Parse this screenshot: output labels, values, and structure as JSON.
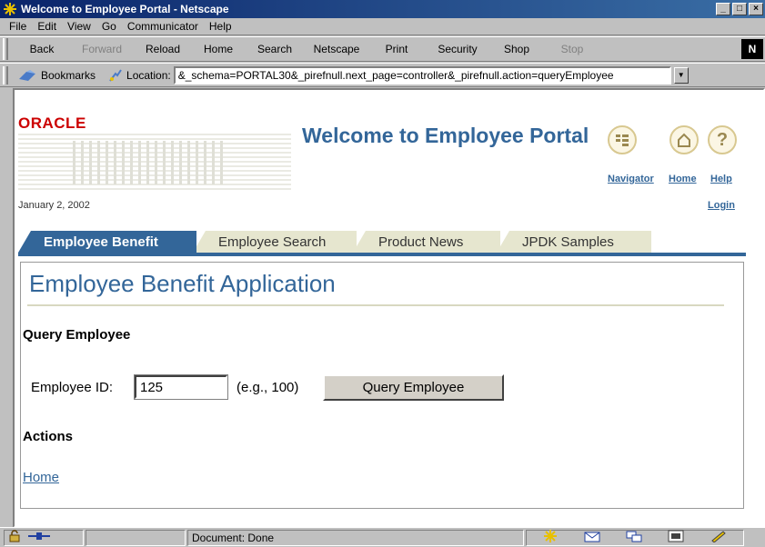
{
  "window": {
    "title": "Welcome to Employee Portal - Netscape",
    "controls": {
      "minimize": "_",
      "maximize": "□",
      "close": "×"
    }
  },
  "menubar": [
    "File",
    "Edit",
    "View",
    "Go",
    "Communicator",
    "Help"
  ],
  "nav_toolbar": {
    "buttons": [
      {
        "label": "Back",
        "enabled": true
      },
      {
        "label": "Forward",
        "enabled": false
      },
      {
        "label": "Reload",
        "enabled": true
      },
      {
        "label": "Home",
        "enabled": true
      },
      {
        "label": "Search",
        "enabled": true
      },
      {
        "label": "Netscape",
        "enabled": true
      },
      {
        "label": "Print",
        "enabled": true
      },
      {
        "label": "Security",
        "enabled": true
      },
      {
        "label": "Shop",
        "enabled": true
      },
      {
        "label": "Stop",
        "enabled": false
      }
    ],
    "logo": "N"
  },
  "location_bar": {
    "bookmarks_label": "Bookmarks",
    "location_label": "Location:",
    "url": "&_schema=PORTAL30&_pirefnull.next_page=controller&_pirefnull.action=queryEmployee"
  },
  "portal": {
    "logo": "ORACLE",
    "title": "Welcome to Employee Portal",
    "links": {
      "navigator": "Navigator",
      "home": "Home",
      "help": "Help",
      "login": "Login"
    },
    "date": "January 2, 2002",
    "tabs": [
      {
        "label": "Employee Benefit",
        "active": true
      },
      {
        "label": "Employee Search",
        "active": false
      },
      {
        "label": "Product News",
        "active": false
      },
      {
        "label": "JPDK Samples",
        "active": false
      }
    ]
  },
  "app": {
    "title": "Employee Benefit Application",
    "query_heading": "Query Employee",
    "employee_id_label": "Employee ID:",
    "employee_id_value": "125",
    "employee_id_hint": "(e.g., 100)",
    "query_button": "Query Employee",
    "actions_heading": "Actions",
    "home_link": "Home"
  },
  "statusbar": {
    "text": "Document: Done"
  },
  "colors": {
    "portal_blue": "#336699",
    "oracle_red": "#cc0000",
    "tab_inactive": "#e6e6cf"
  }
}
